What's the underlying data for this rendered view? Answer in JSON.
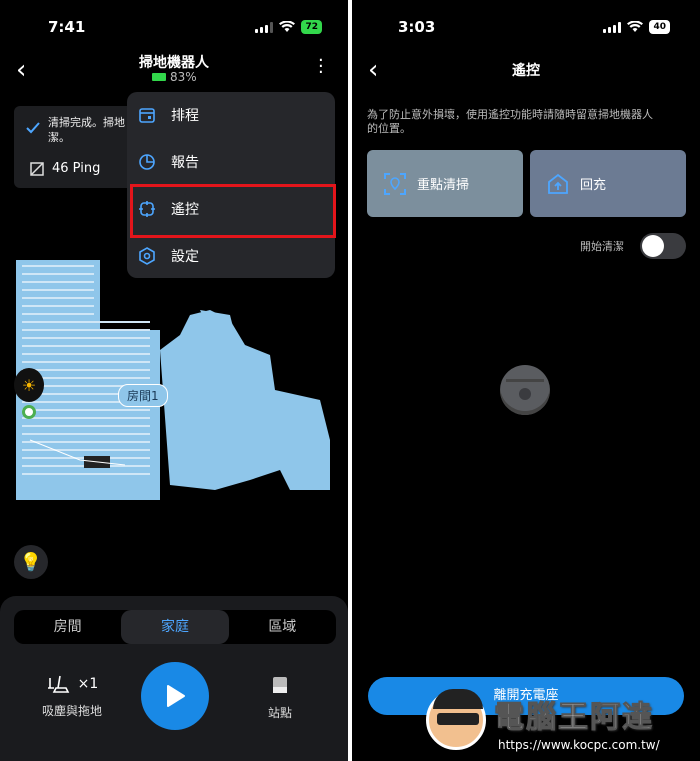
{
  "left": {
    "status_time": "7:41",
    "battery_level": "72",
    "title": "掃地機器人",
    "subtitle_battery": "83%",
    "status_card": {
      "line1": "清掃完成。掃地",
      "line2": "潔。",
      "ping": "46 Ping"
    },
    "menu": [
      {
        "label": "排程",
        "icon": "calendar-icon"
      },
      {
        "label": "報告",
        "icon": "pie-chart-icon"
      },
      {
        "label": "遙控",
        "icon": "remote-control-icon"
      },
      {
        "label": "設定",
        "icon": "gear-icon"
      }
    ],
    "map_room_label": "房間1",
    "tabs": [
      "房間",
      "家庭",
      "區域"
    ],
    "active_tab": "家庭",
    "mode_count": "×1",
    "mode_label": "吸塵與拖地",
    "dock_label": "站點"
  },
  "right": {
    "status_time": "3:03",
    "battery_level": "40",
    "title": "遙控",
    "notice": "為了防止意外損壞，使用遙控功能時請隨時留意掃地機器人的位置。",
    "notice_line1": "為了防止意外損壞，使用遙控功能時請隨時留意掃地機器人",
    "notice_line2": "的位置。",
    "spot_clean_label": "重點清掃",
    "recharge_label": "回充",
    "start_clean_label": "開始清潔",
    "leave_dock_label": "離開充電座"
  },
  "watermark": {
    "title": "電腦王阿達",
    "url": "https://www.kocpc.com.tw/"
  },
  "colors": {
    "accent": "#1989e6",
    "map_blue": "#8fc6ea",
    "highlight": "#e3151b"
  }
}
